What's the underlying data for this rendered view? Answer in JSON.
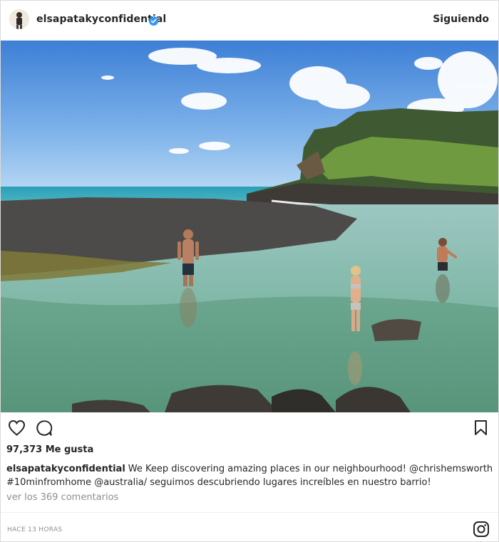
{
  "post": {
    "username": "elsapatakyconfidential",
    "follow_label": "Siguiendo",
    "likes": "97,373 Me gusta",
    "caption_user": "elsapatakyconfidential",
    "caption_text": "We Keep discovering amazing places in our neighbourhood! @chrishemsworth #10minfromhome @australia/ seguimos descubriendo lugares increíbles en nuestro barrio!",
    "comments_link": "ver los 369 comentarios",
    "time_label": "HACE 13 HORAS"
  },
  "icons": {
    "verified": "verified-badge-icon",
    "like": "heart-icon",
    "comment": "comment-bubble-icon",
    "save": "bookmark-icon",
    "brand": "instagram-logo-icon"
  },
  "colors": {
    "verified": "#3897f0",
    "text": "#262626",
    "muted": "#8e8e8e",
    "border": "#dbdbdb"
  }
}
